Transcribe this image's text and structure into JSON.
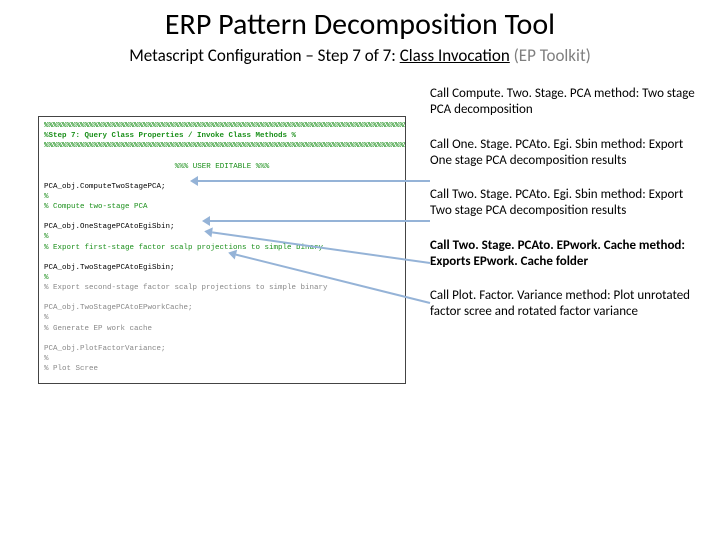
{
  "title": "ERP Pattern Decomposition Tool",
  "subtitle_prefix": "Metascript Configuration – Step 7 of 7: ",
  "subtitle_underline": "Class Invocation",
  "subtitle_ep": " (EP Toolkit)",
  "code": {
    "border_top": "%%%%%%%%%%%%%%%%%%%%%%%%%%%%%%%%%%%%%%%%%%%%%%%%%%%%%%%%%%%%%%%%%%%%%%%%%%%%%%%%%%%",
    "step_label": "%Step 7: Query Class Properties / Invoke Class Methods                            %",
    "border_bot": "%%%%%%%%%%%%%%%%%%%%%%%%%%%%%%%%%%%%%%%%%%%%%%%%%%%%%%%%%%%%%%%%%%%%%%%%%%%%%%%%%%%",
    "user_editable": "%%%  USER EDITABLE  %%%",
    "l1": "PCA_obj.ComputeTwoStagePCA;",
    "l1c": "% Compute two-stage PCA",
    "l2": "PCA_obj.OneStagePCAtoEgiSbin;",
    "l2c": "% Export first-stage factor scalp projections to simple binary",
    "l3": "PCA_obj.TwoStagePCAtoEgiSbin;",
    "l3c": "% Export second-stage factor scalp projections to simple binary",
    "l4": "PCA_obj.TwoStagePCAtoEPworkCache;",
    "l4c": "% Generate EP work cache",
    "l5": "PCA_obj.PlotFactorVariance;",
    "l5c": "% Plot Scree",
    "pct": "%"
  },
  "annotations": [
    "Call Compute. Two. Stage. PCA method: Two stage PCA decomposition",
    "Call One. Stage. PCAto. Egi. Sbin method: Export One stage PCA decomposition results",
    "Call Two. Stage. PCAto. Egi. Sbin method: Export Two stage PCA decomposition results",
    "Call Two. Stage. PCAto. EPwork. Cache method: Exports EPwork. Cache folder",
    "Call Plot. Factor. Variance method: Plot unrotated factor scree and rotated factor variance"
  ]
}
